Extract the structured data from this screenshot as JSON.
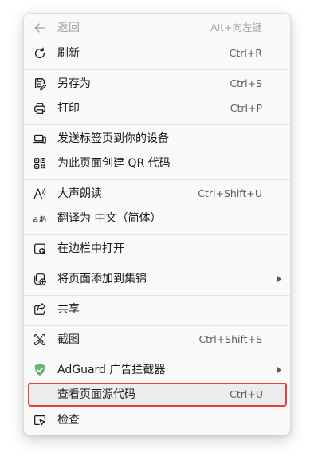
{
  "menu": {
    "items": [
      {
        "label": "返回",
        "shortcut": "Alt+向左键",
        "icon": "back-arrow-icon"
      },
      {
        "label": "刷新",
        "shortcut": "Ctrl+R",
        "icon": "refresh-icon"
      },
      {
        "label": "另存为",
        "shortcut": "Ctrl+S",
        "icon": "save-as-icon"
      },
      {
        "label": "打印",
        "shortcut": "Ctrl+P",
        "icon": "printer-icon"
      },
      {
        "label": "发送标签页到你的设备",
        "shortcut": "",
        "icon": "send-to-device-icon"
      },
      {
        "label": "为此页面创建 QR 代码",
        "shortcut": "",
        "icon": "qr-code-icon"
      },
      {
        "label": "大声朗读",
        "shortcut": "Ctrl+Shift+U",
        "icon": "read-aloud-icon"
      },
      {
        "label": "翻译为 中文（简体）",
        "shortcut": "",
        "icon": "translate-icon"
      },
      {
        "label": "在边栏中打开",
        "shortcut": "",
        "icon": "sidebar-open-icon"
      },
      {
        "label": "将页面添加到集锦",
        "shortcut": "",
        "icon": "collections-add-icon"
      },
      {
        "label": "共享",
        "shortcut": "",
        "icon": "share-icon"
      },
      {
        "label": "截图",
        "shortcut": "Ctrl+Shift+S",
        "icon": "screenshot-icon"
      },
      {
        "label": "AdGuard 广告拦截器",
        "shortcut": "",
        "icon": "adguard-shield-icon"
      },
      {
        "label": "查看页面源代码",
        "shortcut": "Ctrl+U",
        "icon": ""
      },
      {
        "label": "检查",
        "shortcut": "",
        "icon": "inspect-icon"
      }
    ]
  },
  "colors": {
    "highlight_border": "#e5413a",
    "adguard_green": "#67b279"
  }
}
